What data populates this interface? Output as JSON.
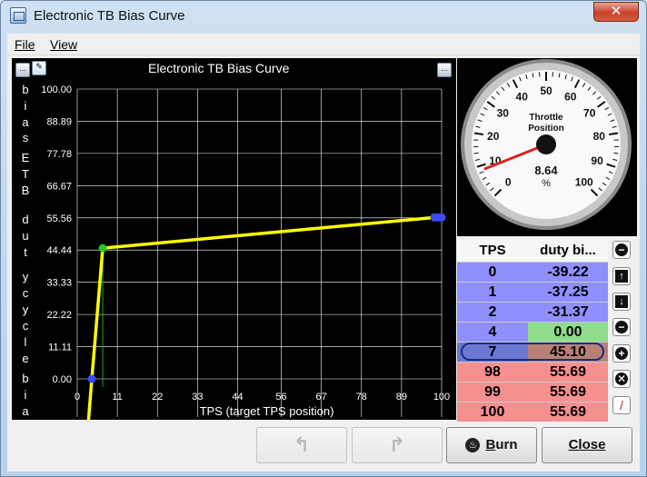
{
  "window": {
    "title": "Electronic TB Bias Curve",
    "close_glyph": "✕"
  },
  "menu": [
    {
      "label": "File"
    },
    {
      "label": "View"
    }
  ],
  "chart_panel": {
    "title": "Electronic TB Bias Curve",
    "menu_button_glyph": "...",
    "ylabel_letters": [
      "b",
      "i",
      "a",
      "s",
      "E",
      "T",
      "B",
      "d",
      "u",
      "t",
      "y",
      "c",
      "y",
      "c",
      "l",
      "e",
      "b",
      "i",
      "a"
    ]
  },
  "chart_data": {
    "type": "line",
    "title": "Electronic TB Bias Curve",
    "xlabel": "TPS (target TPS position)",
    "ylabel": "bias ETB duty cycle bia",
    "xlim": [
      0,
      100
    ],
    "ylim": [
      0,
      100
    ],
    "x_ticks": [
      "0",
      "11",
      "22",
      "33",
      "44",
      "56",
      "67",
      "78",
      "89",
      "100"
    ],
    "y_ticks": [
      "0.00",
      "11.11",
      "22.22",
      "33.33",
      "44.44",
      "55.56",
      "66.67",
      "77.78",
      "88.89",
      "100.00"
    ],
    "grid": true,
    "series": [
      {
        "x": [
          0,
          1,
          2,
          4,
          7,
          98,
          99,
          100
        ],
        "y": [
          -39.22,
          -37.25,
          -31.37,
          0.0,
          45.1,
          55.69,
          55.69,
          55.69
        ]
      }
    ],
    "selected_point": {
      "x": 7,
      "y": 45.1
    },
    "colors": {
      "line": "#ffff00",
      "point": "#3a4cff",
      "selected": "#22cc22",
      "grid": "#ffffff",
      "guide": "#22aa22"
    }
  },
  "gauge": {
    "title_line1": "Throttle",
    "title_line2": "Position",
    "value": "8.64",
    "unit": "%",
    "ticks": [
      "0",
      "10",
      "20",
      "30",
      "40",
      "50",
      "60",
      "70",
      "80",
      "90",
      "100"
    ],
    "needle_value": 8.64
  },
  "table": {
    "headers": [
      "TPS",
      "duty bi..."
    ],
    "rows": [
      {
        "tps": "0",
        "duty": "-39.22",
        "tps_bg": "#8f8fff",
        "duty_bg": "#8f8fff"
      },
      {
        "tps": "1",
        "duty": "-37.25",
        "tps_bg": "#8f8fff",
        "duty_bg": "#8f8fff"
      },
      {
        "tps": "2",
        "duty": "-31.37",
        "tps_bg": "#8f8fff",
        "duty_bg": "#8f8fff"
      },
      {
        "tps": "4",
        "duty": "0.00",
        "tps_bg": "#8f8fff",
        "duty_bg": "#8fdc8f"
      },
      {
        "tps": "7",
        "duty": "45.10",
        "tps_bg": "#6b78d0",
        "duty_bg": "#b98176"
      },
      {
        "tps": "98",
        "duty": "55.69",
        "tps_bg": "#f59090",
        "duty_bg": "#f59090"
      },
      {
        "tps": "99",
        "duty": "55.69",
        "tps_bg": "#f59090",
        "duty_bg": "#f59090"
      },
      {
        "tps": "100",
        "duty": "55.69",
        "tps_bg": "#f59090",
        "duty_bg": "#f59090"
      }
    ]
  },
  "side_buttons": [
    {
      "name": "collapse-button",
      "icon": "minus-circle-icon",
      "glyph": "−"
    },
    {
      "name": "move-up-button",
      "icon": "arrow-up-icon",
      "glyph": "↑"
    },
    {
      "name": "move-down-button",
      "icon": "arrow-down-icon",
      "glyph": "↓"
    },
    {
      "name": "remove-row-button",
      "icon": "minus-circle-icon",
      "glyph": "−"
    },
    {
      "name": "add-row-button",
      "icon": "plus-circle-icon",
      "glyph": "+"
    },
    {
      "name": "delete-button",
      "icon": "x-circle-icon",
      "glyph": "✕"
    },
    {
      "name": "edit-button",
      "icon": "pencil-icon",
      "glyph": "/"
    }
  ],
  "buttons": {
    "undo_glyph": "↰",
    "redo_glyph": "↱",
    "burn_label_first": "B",
    "burn_label_rest": "urn",
    "close_label_first": "C",
    "close_label_rest": "lose"
  }
}
